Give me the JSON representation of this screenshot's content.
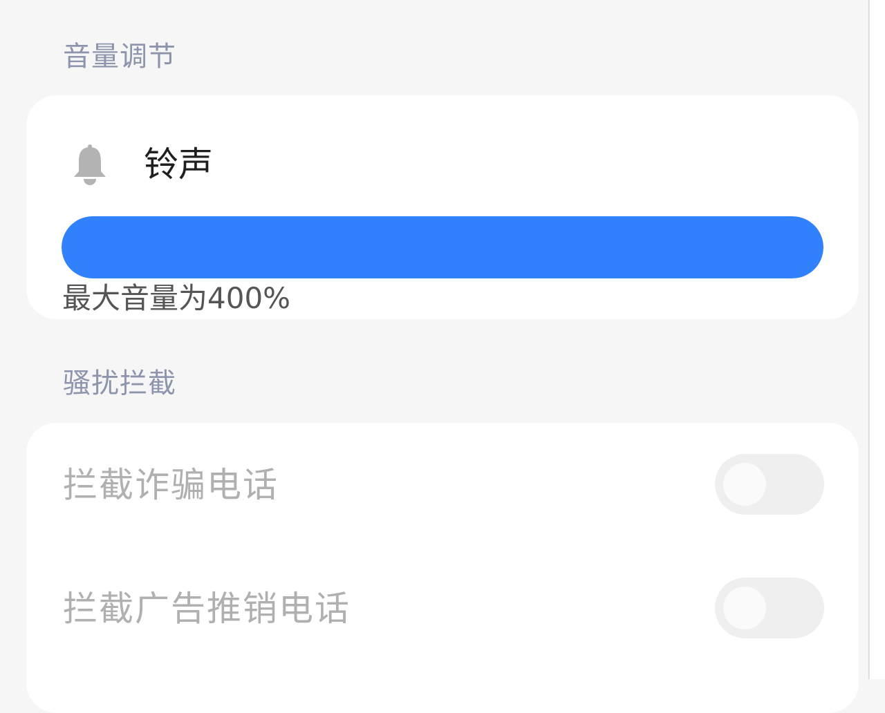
{
  "sections": {
    "volume": {
      "title": "音量调节",
      "ringtone": {
        "icon": "bell-icon",
        "label": "铃声",
        "level": 1.0,
        "fill_color": "#3281fc"
      },
      "max_note": "最大音量为400%"
    },
    "harassment": {
      "title": "骚扰拦截",
      "items": [
        {
          "label": "拦截诈骗电话",
          "enabled": false
        },
        {
          "label": "拦截广告推销电话",
          "enabled": false
        }
      ]
    }
  }
}
